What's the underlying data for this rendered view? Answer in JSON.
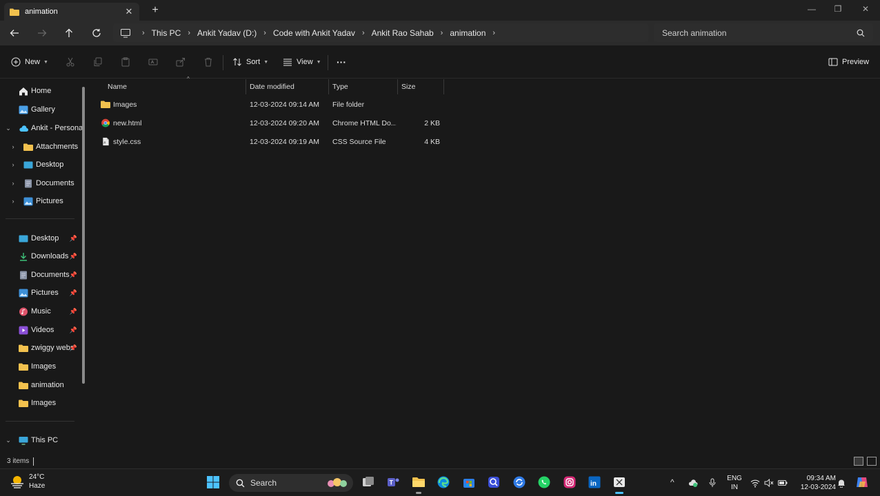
{
  "window": {
    "tab_label": "animation",
    "tab_close": "✕",
    "new_tab": "+",
    "minimize": "—",
    "maximize": "❐",
    "close": "✕"
  },
  "breadcrumb": [
    "This PC",
    "Ankit Yadav (D:)",
    "Code with Ankit Yadav",
    "Ankit Rao Sahab",
    "animation"
  ],
  "search": {
    "placeholder": "Search animation"
  },
  "toolbar": {
    "new_label": "New",
    "sort_label": "Sort",
    "view_label": "View",
    "more_label": "···",
    "preview_label": "Preview"
  },
  "sidebar": {
    "home": "Home",
    "gallery": "Gallery",
    "onedrive": "Ankit - Personal",
    "onedrive_children": [
      "Attachments",
      "Desktop",
      "Documents",
      "Pictures"
    ],
    "quick_access": [
      "Desktop",
      "Downloads",
      "Documents",
      "Pictures",
      "Music",
      "Videos",
      "zwiggy webs",
      "Images",
      "animation",
      "Images"
    ],
    "this_pc": "This PC"
  },
  "columns": {
    "name": "Name",
    "date": "Date modified",
    "type": "Type",
    "size": "Size"
  },
  "files": [
    {
      "name": "Images",
      "date": "12-03-2024 09:14 AM",
      "type": "File folder",
      "size": "",
      "icon": "folder-icon"
    },
    {
      "name": "new.html",
      "date": "12-03-2024 09:20 AM",
      "type": "Chrome HTML Do...",
      "size": "2 KB",
      "icon": "chrome-icon"
    },
    {
      "name": "style.css",
      "date": "12-03-2024 09:19 AM",
      "type": "CSS Source File",
      "size": "4 KB",
      "icon": "css-file-icon"
    }
  ],
  "status": {
    "count": "3 items"
  },
  "taskbar": {
    "temp": "24°C",
    "condition": "Haze",
    "search_label": "Search",
    "lang_top": "ENG",
    "lang_bottom": "IN",
    "time": "09:34 AM",
    "date": "12-03-2024"
  },
  "colors": {
    "folder": "#f2c14e",
    "accent": "#4cc2ff",
    "background": "#191919"
  }
}
